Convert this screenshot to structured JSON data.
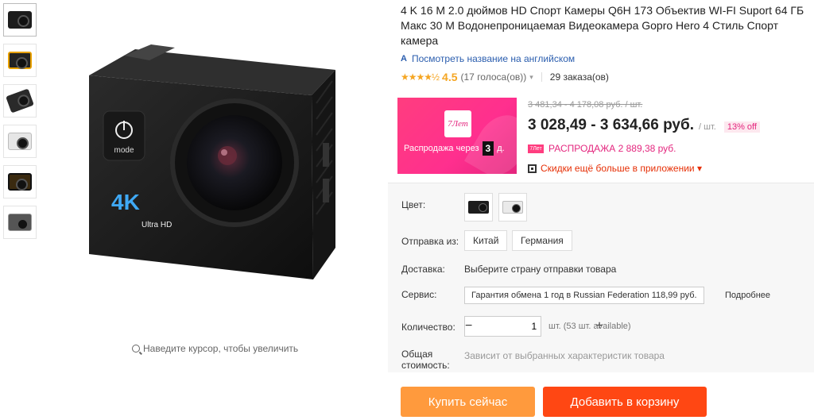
{
  "gallery": {
    "zoom_hint": "Наведите курсор, чтобы увеличить",
    "camera_text": "4K",
    "camera_sub": "Ultra HD",
    "mode_label": "mode"
  },
  "product": {
    "title": "4 K 16 M 2.0 дюймов HD Спорт Камеры Q6H 173 Объектив WI-FI Suport 64 ГБ Макс 30 М Водонепроницаемая Видеокамера Gopro Hero 4 Стиль Спорт камера",
    "translate_link": "Посмотреть название на английском",
    "translate_icon": "A",
    "stars": "★★★★½",
    "rating": "4.5",
    "votes": "(17 голоса(ов))",
    "orders": "29 заказа(ов)"
  },
  "sale": {
    "badge_text": "7Лет",
    "countdown_label": "Распродажа через",
    "days_value": "3",
    "days_unit": "д.",
    "old_price": "3 481,34 - 4 178,08 руб. / шт.",
    "price": "3 028,49 - 3 634,66 руб.",
    "unit": "/ шт.",
    "off": "13% off",
    "mini_badge": "7Лет",
    "promo_price": "РАСПРОДАЖА 2 889,38 руб.",
    "app_discount": "Скидки ещё больше в приложении ▾"
  },
  "options": {
    "color_label": "Цвет:",
    "ship_from_label": "Отправка из:",
    "ship_from": [
      "Китай",
      "Германия"
    ],
    "delivery_label": "Доставка:",
    "delivery_value": "Выберите страну отправки товара",
    "service_label": "Сервис:",
    "service_value": "Гарантия обмена 1 год в Russian Federation 118,99 руб.",
    "service_more": "Подробнее",
    "quantity_label": "Количество:",
    "quantity_value": "1",
    "quantity_minus": "−",
    "quantity_plus": "+",
    "quantity_note": "шт. (53 шт. available)",
    "total_label_1": "Общая",
    "total_label_2": "стоимость:",
    "total_value": "Зависит от выбранных характеристик товара"
  },
  "actions": {
    "buy_now": "Купить сейчас",
    "add_to_cart": "Добавить в корзину"
  },
  "colors": {
    "price_pink": "#e4267e",
    "buy_orange": "#ff9a3d",
    "cart_red": "#ff4713",
    "star": "#f5a623"
  }
}
